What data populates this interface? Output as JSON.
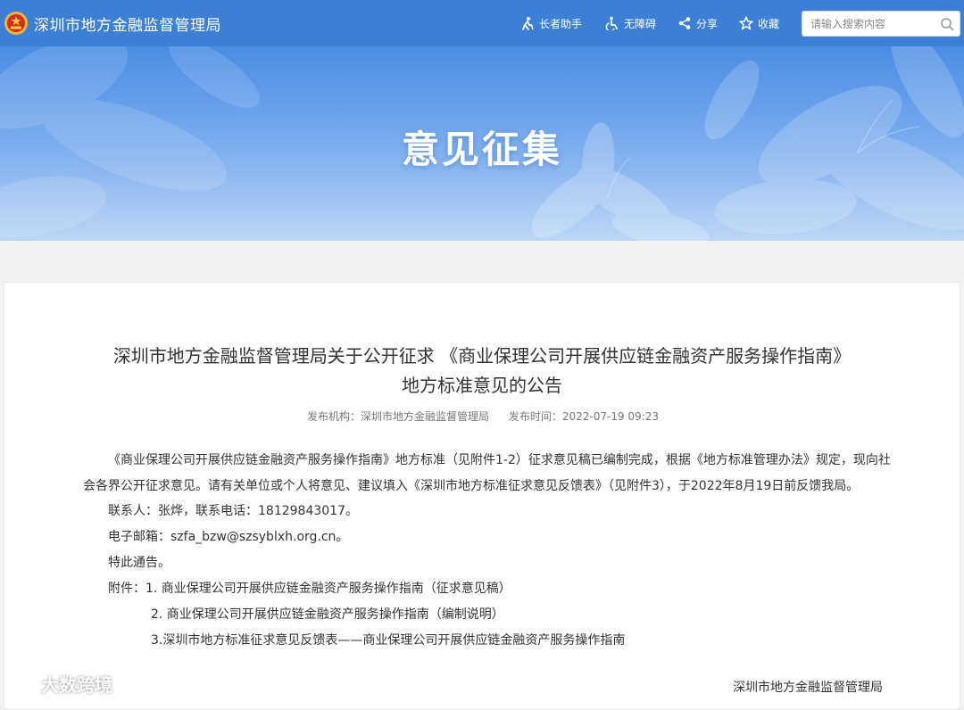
{
  "header": {
    "site_title": "深圳市地方金融监督管理局",
    "tools": [
      {
        "label": "长者助手",
        "icon": "elder-assist-icon"
      },
      {
        "label": "无障碍",
        "icon": "accessibility-icon"
      },
      {
        "label": "分享",
        "icon": "share-icon"
      },
      {
        "label": "收藏",
        "icon": "star-icon"
      }
    ],
    "search_placeholder": "请输入搜索内容"
  },
  "banner": {
    "title": "意见征集"
  },
  "article": {
    "title_line1": "深圳市地方金融监督管理局关于公开征求 《商业保理公司开展供应链金融资产服务操作指南》",
    "title_line2": "地方标准意见的公告",
    "publisher_label": "发布机构：",
    "publisher": "深圳市地方金融监督管理局",
    "time_label": "发布时间：",
    "time": "2022-07-19 09:23",
    "paragraph": "《商业保理公司开展供应链金融资产服务操作指南》地方标准（见附件1-2）征求意见稿已编制完成，根据《地方标准管理办法》规定，现向社会各界公开征求意见。请有关单位或个人将意见、建议填入《深圳市地方标准征求意见反馈表》（见附件3），于2022年8月19日前反馈我局。",
    "contact": "联系人：张烨，联系电话：18129843017。",
    "email": "电子邮箱：szfa_bzw@szsyblxh.org.cn。",
    "notice": "特此通告。",
    "attachments_label": "附件：",
    "attachments": [
      "1. 商业保理公司开展供应链金融资产服务操作指南（征求意见稿）",
      "2. 商业保理公司开展供应链金融资产服务操作指南（编制说明）",
      "3.深圳市地方标准征求意见反馈表——商业保理公司开展供应链金融资产服务操作指南"
    ],
    "signature": "深圳市地方金融监督管理局"
  },
  "watermark": {
    "text": "大数跨境"
  },
  "colors": {
    "header_bg": "#3d7fd6",
    "banner_top": "#4a8ce3",
    "page_bg": "#f2f2f2"
  }
}
